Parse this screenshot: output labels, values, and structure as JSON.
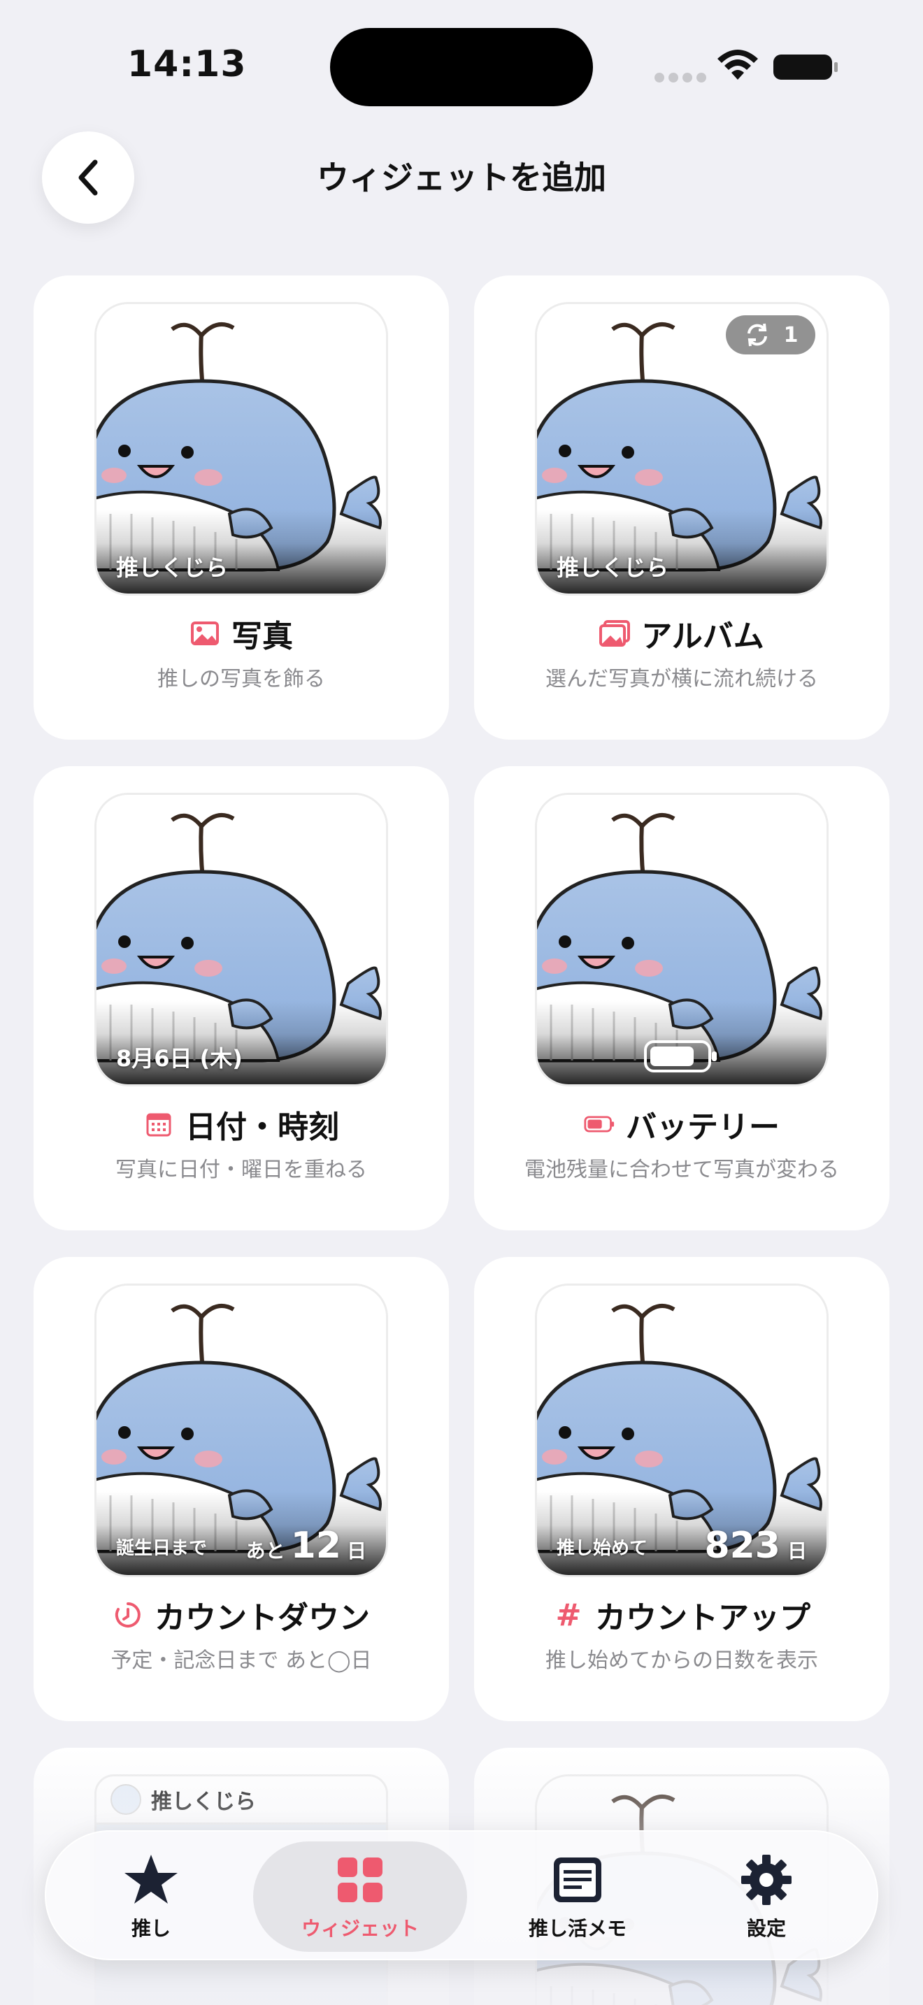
{
  "status": {
    "time": "14:13"
  },
  "header": {
    "title": "ウィジェットを追加"
  },
  "widgets": [
    {
      "title": "写真",
      "desc": "推しの写真を飾る",
      "overlay": "推しくじら",
      "icon": "photo-icon"
    },
    {
      "title": "アルバム",
      "desc": "選んだ写真が横に流れ続ける",
      "overlay": "推しくじら",
      "badge_count": "1",
      "icon": "album-icon"
    },
    {
      "title": "日付・時刻",
      "desc": "写真に日付・曜日を重ねる",
      "overlay": "8月6日 (木)",
      "icon": "calendar-icon"
    },
    {
      "title": "バッテリー",
      "desc": "電池残量に合わせて写真が変わる",
      "icon": "battery-icon"
    },
    {
      "title": "カウントダウン",
      "desc": "予定・記念日まで あと◯日",
      "overlay_left": "誕生日まで",
      "overlay_prefix": "あと",
      "number": "12",
      "unit": "日",
      "icon": "timer-icon"
    },
    {
      "title": "カウントアップ",
      "desc": "推し始めてからの日数を表示",
      "overlay_left": "推し始めて",
      "number": "823",
      "unit": "日",
      "icon": "hash-icon"
    }
  ],
  "partial": {
    "memo_name": "推しくじら"
  },
  "tabs": [
    {
      "label": "推し",
      "icon": "star-icon"
    },
    {
      "label": "ウィジェット",
      "icon": "grid-icon",
      "active": true
    },
    {
      "label": "推し活メモ",
      "icon": "note-icon"
    },
    {
      "label": "設定",
      "icon": "gear-icon"
    }
  ],
  "colors": {
    "accent": "#ee5a6f",
    "background": "#f0f0f5",
    "card": "#ffffff",
    "muted": "#8a8a8e"
  }
}
